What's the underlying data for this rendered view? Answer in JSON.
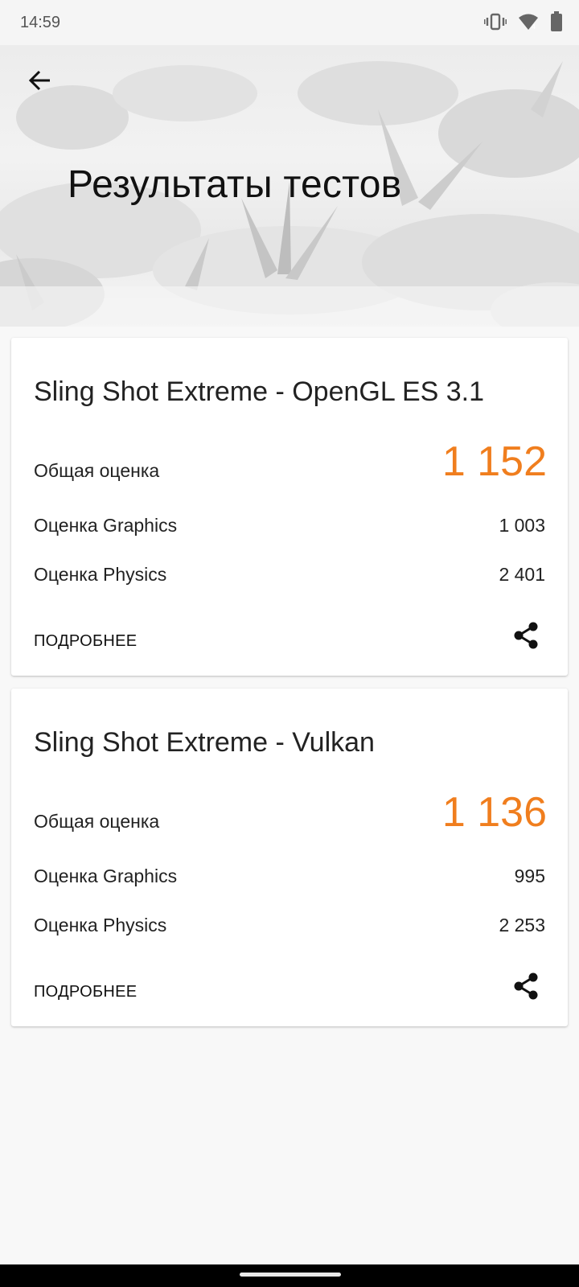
{
  "status_bar": {
    "time": "14:59",
    "icons": [
      "vibrate-icon",
      "wifi-icon",
      "battery-icon"
    ]
  },
  "header": {
    "back_icon": "arrow-left-icon",
    "title": "Результаты тестов"
  },
  "accent_color": "#f07e1e",
  "results": [
    {
      "title": "Sling Shot Extreme - OpenGL ES 3.1",
      "overall_label": "Общая оценка",
      "overall_value": "1 152",
      "graphics_label": "Оценка Graphics",
      "graphics_value": "1 003",
      "physics_label": "Оценка Physics",
      "physics_value": "2 401",
      "details_label": "ПОДРОБНЕЕ",
      "share_icon": "share-icon"
    },
    {
      "title": "Sling Shot Extreme - Vulkan",
      "overall_label": "Общая оценка",
      "overall_value": "1 136",
      "graphics_label": "Оценка Graphics",
      "graphics_value": "995",
      "physics_label": "Оценка Physics",
      "physics_value": "2 253",
      "details_label": "ПОДРОБНЕЕ",
      "share_icon": "share-icon"
    }
  ]
}
